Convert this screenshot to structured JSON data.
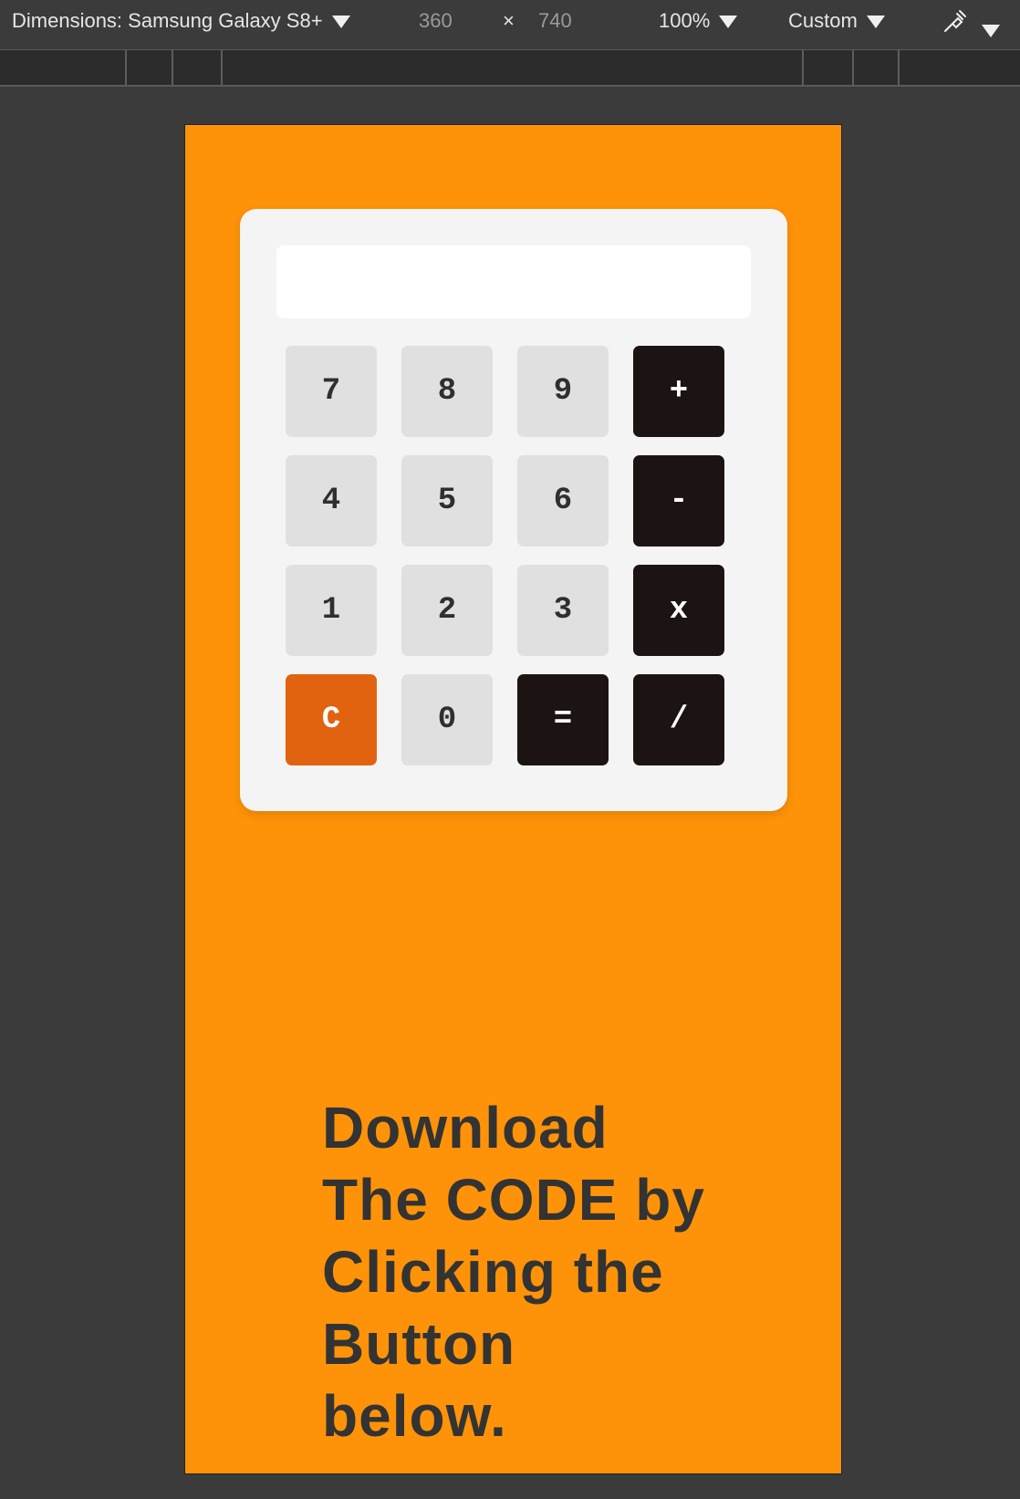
{
  "toolbar": {
    "device_label": "Dimensions: Samsung Galaxy S8+",
    "width": "360",
    "times": "×",
    "height": "740",
    "zoom": "100%",
    "throttle": "Custom"
  },
  "calculator": {
    "display_value": "",
    "keys": [
      "7",
      "8",
      "9",
      "+",
      "4",
      "5",
      "6",
      "-",
      "1",
      "2",
      "3",
      "x",
      "C",
      "0",
      "=",
      "/"
    ]
  },
  "promo": {
    "text": "Download\nThe CODE by\nClicking  the\nButton\nbelow."
  },
  "colors": {
    "page_bg": "#fe9309",
    "calculator_bg": "#f4f4f4",
    "number_key": "#e0e0e0",
    "operator_key": "#1c1413",
    "clear_key": "#e1630f",
    "text_dark": "#333333"
  }
}
